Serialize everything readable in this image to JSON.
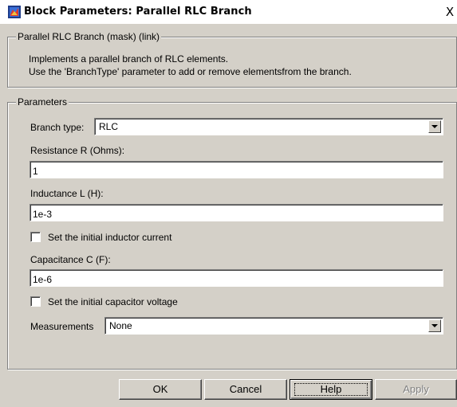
{
  "window": {
    "title": "Block Parameters: Parallel RLC Branch",
    "close_label": "X"
  },
  "mask_group": {
    "legend": "Parallel RLC Branch (mask) (link)",
    "description_line1": "Implements a parallel branch of RLC elements.",
    "description_line2": "Use the 'BranchType' parameter to add or remove elementsfrom the branch."
  },
  "params_group": {
    "legend": "Parameters",
    "branch_type_label": "Branch type:",
    "branch_type_value": "RLC",
    "resistance_label": "Resistance R (Ohms):",
    "resistance_value": "1",
    "inductance_label": "Inductance L (H):",
    "inductance_value": "1e-3",
    "inductor_current_label": "Set the initial inductor current",
    "inductor_current_checked": false,
    "capacitance_label": "Capacitance C (F):",
    "capacitance_value": "1e-6",
    "capacitor_voltage_label": "Set the initial capacitor voltage",
    "capacitor_voltage_checked": false,
    "measurements_label": "Measurements",
    "measurements_value": "None"
  },
  "buttons": {
    "ok": "OK",
    "cancel": "Cancel",
    "help": "Help",
    "apply": "Apply"
  },
  "icons": {
    "title_icon": "simulink-block-icon",
    "dropdown_arrow": "chevron-down-icon"
  }
}
